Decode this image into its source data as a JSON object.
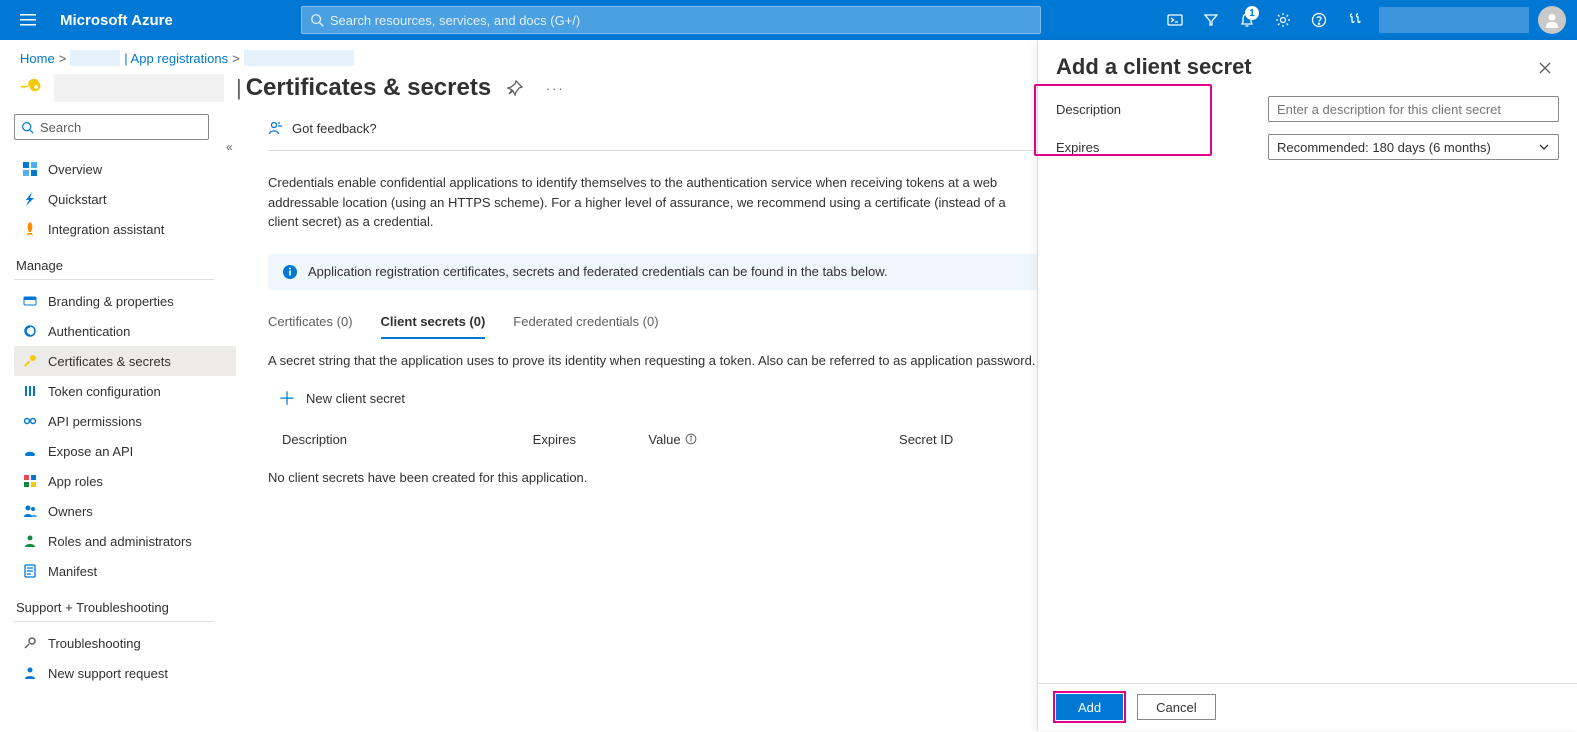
{
  "brand": "Microsoft Azure",
  "search_placeholder": "Search resources, services, and docs (G+/)",
  "notifications_badge": "1",
  "crumbs": {
    "home": "Home",
    "appreg": "| App registrations"
  },
  "page_title": "Certificates & secrets",
  "sidebar_search_placeholder": "Search",
  "nav": {
    "overview": "Overview",
    "quickstart": "Quickstart",
    "integration": "Integration assistant",
    "section_manage": "Manage",
    "branding": "Branding & properties",
    "authentication": "Authentication",
    "certsecrets": "Certificates & secrets",
    "tokenconfig": "Token configuration",
    "apiperm": "API permissions",
    "exposeapi": "Expose an API",
    "approles": "App roles",
    "owners": "Owners",
    "rolesadmins": "Roles and administrators",
    "manifest": "Manifest",
    "section_support": "Support + Troubleshooting",
    "troubleshooting": "Troubleshooting",
    "newsupport": "New support request"
  },
  "main": {
    "feedback": "Got feedback?",
    "desc": "Credentials enable confidential applications to identify themselves to the authentication service when receiving tokens at a web addressable location (using an HTTPS scheme). For a higher level of assurance, we recommend using a certificate (instead of a client secret) as a credential.",
    "info": "Application registration certificates, secrets and federated credentials can be found in the tabs below.",
    "tabs": {
      "certificates": "Certificates (0)",
      "clientsecrets": "Client secrets (0)",
      "federated": "Federated credentials (0)"
    },
    "tabdesc": "A secret string that the application uses to prove its identity when requesting a token. Also can be referred to as application password.",
    "newsecret": "New client secret",
    "columns": {
      "description": "Description",
      "expires": "Expires",
      "value": "Value",
      "secretid": "Secret ID"
    },
    "empty": "No client secrets have been created for this application."
  },
  "panel": {
    "title": "Add a client secret",
    "description_label": "Description",
    "description_placeholder": "Enter a description for this client secret",
    "expires_label": "Expires",
    "expires_value": "Recommended: 180 days (6 months)",
    "add": "Add",
    "cancel": "Cancel"
  }
}
